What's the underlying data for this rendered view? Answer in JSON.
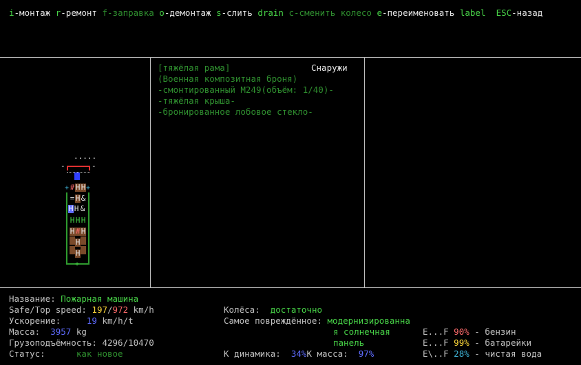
{
  "keybar": [
    {
      "key": "i",
      "label": "-монтаж"
    },
    {
      "key": "r",
      "label": "-ремонт"
    },
    {
      "key": "f",
      "label": "-заправка",
      "disabled": true
    },
    {
      "key": "o",
      "label": "-демонтаж"
    },
    {
      "key": "s",
      "label": "-слить"
    },
    {
      "key": "drain",
      "label": ""
    },
    {
      "key": "c",
      "label": "-сменить колесо",
      "disabled": true
    },
    {
      "key": "e",
      "label": "-переименовать"
    },
    {
      "key": "label",
      "label": ""
    },
    {
      "key": "ESC",
      "label": "-назад"
    }
  ],
  "part_panel": {
    "heading": "[тяжёлая рама]",
    "location": "Снаружи",
    "lines": [
      "(Военная композитная броня)",
      "-смонтированный M249(объём: 1/40)-",
      "-тяжёлая крыша-",
      "-бронированное лобовое стекло-"
    ]
  },
  "stats": {
    "name_label": "Название:",
    "name_value": "Пожарная машина",
    "speed_label": "Safe/Top speed:",
    "speed_safe": "197",
    "speed_sep": "/",
    "speed_top": "972",
    "speed_unit": "km/h",
    "accel_label": "Ускорение:",
    "accel_value": "19",
    "accel_unit": "km/h/t",
    "mass_label": "Масса:",
    "mass_value": "3957",
    "mass_unit": "kg",
    "cargo_label": "Грузоподъёмность:",
    "cargo_value": "4296/10470",
    "status_label": "Статус:",
    "status_value": "как новое",
    "wheels_label": "Колёса:",
    "wheels_value": "достаточно",
    "damaged_label": "Самое повреждённое:",
    "damaged_value_1": "модернизированна",
    "damaged_value_2": "я солнечная",
    "damaged_value_3": "панель",
    "dyn_label": "К динамика:",
    "dyn_value": "34%",
    "kmass_label": "K масса:",
    "kmass_value": "97%"
  },
  "fuel": [
    {
      "gauge": "E...F",
      "pct": "90%",
      "name": "- бензин",
      "color": "#ff6b6b"
    },
    {
      "gauge": "E...F",
      "pct": "99%",
      "name": "- батарейки",
      "color": "#ffd93a"
    },
    {
      "gauge": "E\\..F",
      "pct": "28%",
      "name": "- чистая вода",
      "color": "#3fb3d6"
    }
  ],
  "sprite": {
    "dots": ".....",
    "bumper_left": "-",
    "bumper_right": "-",
    "plus": "+",
    "hash": "#",
    "H": "H",
    "eq": "=",
    "amp": "&"
  }
}
